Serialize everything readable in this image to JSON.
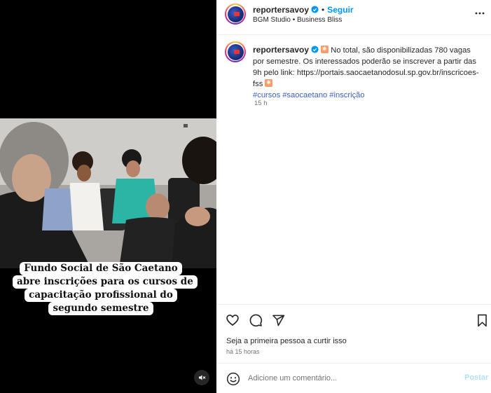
{
  "post": {
    "username": "reportersavoy",
    "follow_label": "Seguir",
    "dot": "•",
    "audio": "BGM Studio • Business Bliss"
  },
  "media": {
    "overlay_lines": [
      "Fundo Social de São Caetano",
      "abre inscrições para os cursos de",
      "capacitação profissional do",
      "segundo semestre"
    ]
  },
  "caption": {
    "username": "reportersavoy",
    "text": "No total, são disponibilizadas 780 vagas por semestre. Os interessados poderão se inscrever a partir das 9h pelo link: https://portais.saocaetanodosul.sp.gov.br/inscricoes-fss",
    "hashtags": [
      "#cursos",
      "#saocaetano",
      "#inscrição"
    ],
    "time": "15 h"
  },
  "engagement": {
    "likes_text": "Seja a primeira pessoa a curtir isso",
    "posted_ago": "há 15 horas"
  },
  "comment_box": {
    "placeholder": "Adicione um comentário...",
    "post_label": "Postar"
  },
  "colors": {
    "accent": "#0095f6",
    "hashtag": "#3a5fc8",
    "muted": "#737373"
  },
  "icons": [
    "verified-badge-icon",
    "more-options-icon",
    "heart-icon",
    "comment-icon",
    "share-icon",
    "bookmark-icon",
    "emoji-icon",
    "audio-muted-icon"
  ]
}
